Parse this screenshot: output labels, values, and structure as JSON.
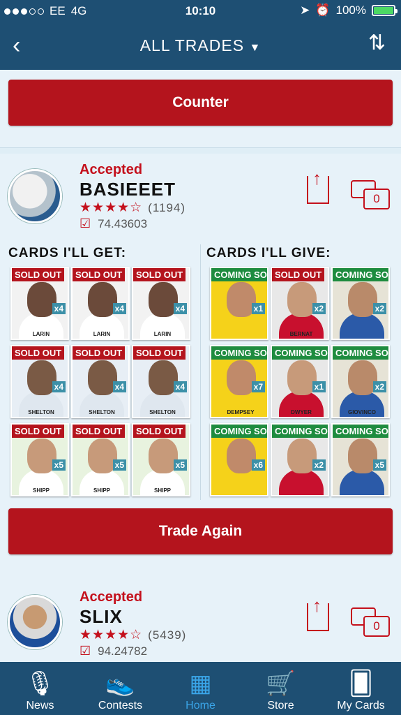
{
  "statusbar": {
    "carrier": "EE",
    "network": "4G",
    "time": "10:10",
    "battery": "100%",
    "signal_dots": 5,
    "signal_filled": 3
  },
  "navbar": {
    "title": "ALL TRADES",
    "title_caret": "▼",
    "back_icon": "chevron-left-icon",
    "sort_icon": "sort-arrows-icon"
  },
  "counter_button": "Counter",
  "trade1": {
    "status": "Accepted",
    "username": "BASIEEET",
    "rating_stars": "★★★★☆",
    "rating_count": "(1194)",
    "score": "74.43603",
    "get_heading": "CARDS I'LL GET:",
    "give_heading": "CARDS I'LL GIVE:",
    "get_cards": [
      {
        "banner": "SOLD OUT",
        "qty": "x4",
        "name": "LARIN"
      },
      {
        "banner": "SOLD OUT",
        "qty": "x4",
        "name": "LARIN"
      },
      {
        "banner": "SOLD OUT",
        "qty": "x4",
        "name": "LARIN"
      },
      {
        "banner": "SOLD OUT",
        "qty": "x4",
        "name": "SHELTON"
      },
      {
        "banner": "SOLD OUT",
        "qty": "x4",
        "name": "SHELTON"
      },
      {
        "banner": "SOLD OUT",
        "qty": "x4",
        "name": "SHELTON"
      },
      {
        "banner": "SOLD OUT",
        "qty": "x5",
        "name": "SHIPP"
      },
      {
        "banner": "SOLD OUT",
        "qty": "x5",
        "name": "SHIPP"
      },
      {
        "banner": "SOLD OUT",
        "qty": "x5",
        "name": "SHIPP"
      }
    ],
    "give_cards": [
      {
        "banner": "COMING SOON",
        "qty": "x1",
        "name": ""
      },
      {
        "banner": "SOLD OUT",
        "qty": "x2",
        "name": "BERNAT"
      },
      {
        "banner": "COMING SOON",
        "qty": "x2",
        "name": ""
      },
      {
        "banner": "COMING SOON",
        "qty": "x7",
        "name": "DEMPSEY"
      },
      {
        "banner": "COMING SOON",
        "qty": "x1",
        "name": "DWYER"
      },
      {
        "banner": "COMING SOON",
        "qty": "x2",
        "name": "GIOVINCO"
      },
      {
        "banner": "COMING SOON",
        "qty": "x6",
        "name": ""
      },
      {
        "banner": "COMING SOON",
        "qty": "x2",
        "name": ""
      },
      {
        "banner": "COMING SOON",
        "qty": "x5",
        "name": ""
      }
    ],
    "trade_again": "Trade Again"
  },
  "trade2": {
    "status": "Accepted",
    "username": "SLIX",
    "rating_stars": "★★★★☆",
    "rating_count": "(5439)",
    "score": "94.24782"
  },
  "chat_count": "0",
  "tabs": [
    {
      "label": "News",
      "icon": "microphone-icon"
    },
    {
      "label": "Contests",
      "icon": "cleat-icon"
    },
    {
      "label": "Home",
      "icon": "goal-net-icon",
      "active": true
    },
    {
      "label": "Store",
      "icon": "cart-icon"
    },
    {
      "label": "My Cards",
      "icon": "cards-icon"
    }
  ],
  "colors": {
    "nav": "#1e4f73",
    "accent_red": "#b4141d",
    "soon_green": "#1e8c3f",
    "active_tab": "#3aa5e8"
  }
}
